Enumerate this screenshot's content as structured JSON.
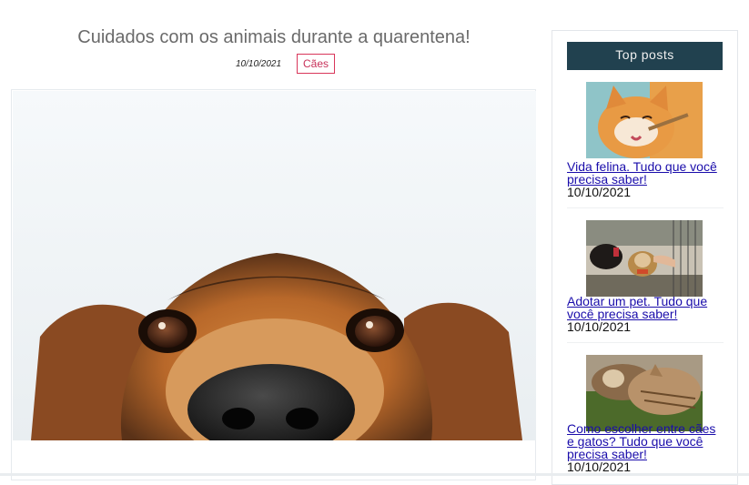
{
  "post": {
    "title": "Cuidados com os animais durante a quarentena!",
    "date": "10/10/2021",
    "category": "Cães"
  },
  "sidebar": {
    "title": "Top posts",
    "posts": [
      {
        "title": "Vida felina. Tudo que você precisa saber!",
        "date": "10/10/2021"
      },
      {
        "title": "Adotar um pet. Tudo que você precisa saber!",
        "date": "10/10/2021"
      },
      {
        "title": "Como escolher entre cães e gatos? Tudo que você precisa saber!",
        "date": "10/10/2021"
      }
    ]
  }
}
